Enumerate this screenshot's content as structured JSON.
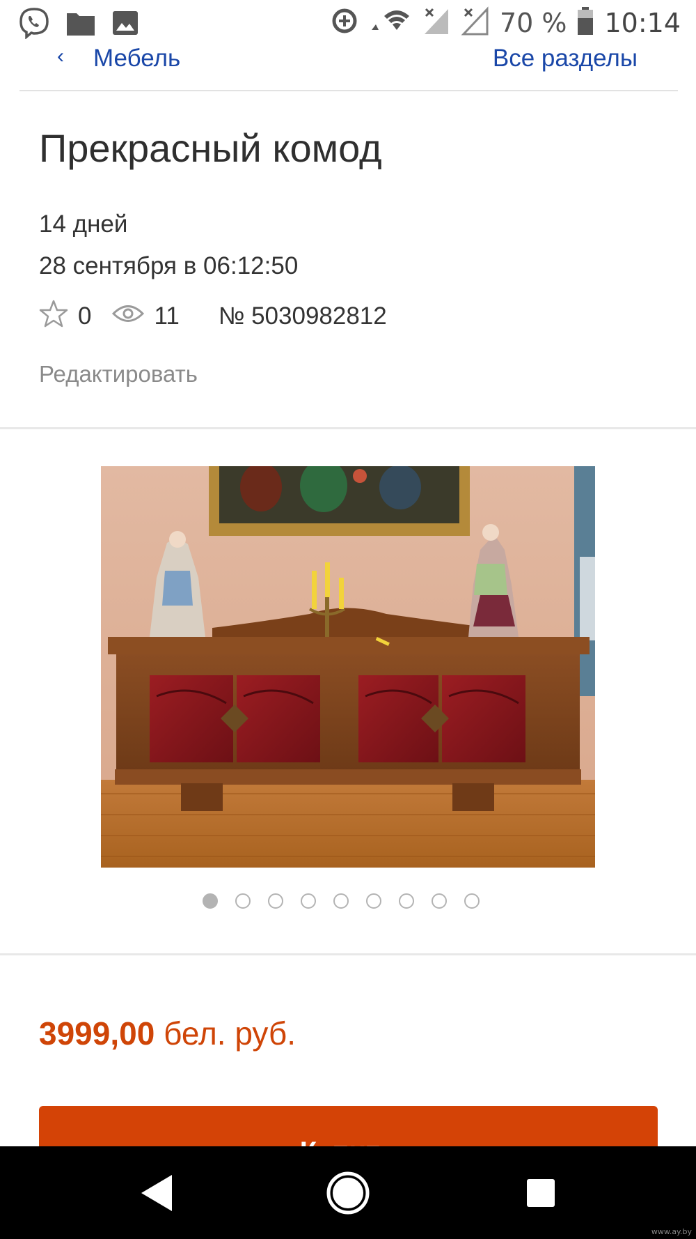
{
  "status_bar": {
    "battery": "70 %",
    "time": "10:14",
    "icons": [
      "viber-icon",
      "folder-icon",
      "image-icon",
      "data-saver-icon",
      "wifi-icon",
      "signal-icon",
      "signal-icon-2",
      "battery-icon"
    ]
  },
  "nav": {
    "back_symbol": "‹",
    "category": "Мебель",
    "all_sections": "Все разделы"
  },
  "lot": {
    "title": "Прекрасный комод",
    "duration": "14 дней",
    "date": "28 сентября в 06:12:50",
    "favorites_count": "0",
    "views_count": "11",
    "lot_number": "№ 5030982812",
    "edit_label": "Редактировать"
  },
  "gallery": {
    "total_images": 9,
    "active_index": 0,
    "image_subject": "sideboard-photo"
  },
  "price": {
    "amount": "3999,00",
    "currency": "бел. руб."
  },
  "buy_button": {
    "label": "Купить"
  },
  "watermark": "www.ay.by",
  "colors": {
    "link": "#1a47a8",
    "price": "#cf4507",
    "button": "#d44306",
    "text": "#333333",
    "muted": "#8a8a8a"
  }
}
